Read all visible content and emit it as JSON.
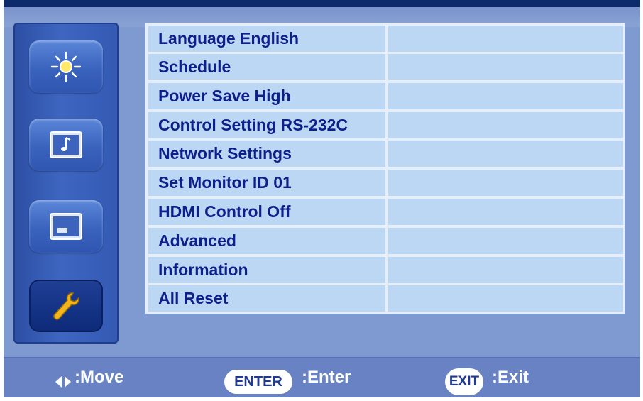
{
  "sidebar": {
    "items": [
      {
        "icon": "brightness-icon"
      },
      {
        "icon": "music-note-icon"
      },
      {
        "icon": "screen-icon"
      },
      {
        "icon": "wrench-icon",
        "active": true
      }
    ]
  },
  "menu": {
    "rows": [
      {
        "label": "Language English"
      },
      {
        "label": "Schedule"
      },
      {
        "label": "Power Save High"
      },
      {
        "label": "Control Setting RS-232C"
      },
      {
        "label": "Network Settings"
      },
      {
        "label": "Set Monitor ID 01"
      },
      {
        "label": "HDMI Control Off"
      },
      {
        "label": "Advanced"
      },
      {
        "label": "Information"
      },
      {
        "label": "All Reset"
      }
    ]
  },
  "footer": {
    "move": ":Move",
    "enter_key": "ENTER",
    "enter": ":Enter",
    "exit_key": "EXIT",
    "exit": ":Exit"
  },
  "colors": {
    "label_text": "#0c1f8a",
    "row_bg": "#bcd7f3",
    "footer_bg": "#6882c3"
  }
}
